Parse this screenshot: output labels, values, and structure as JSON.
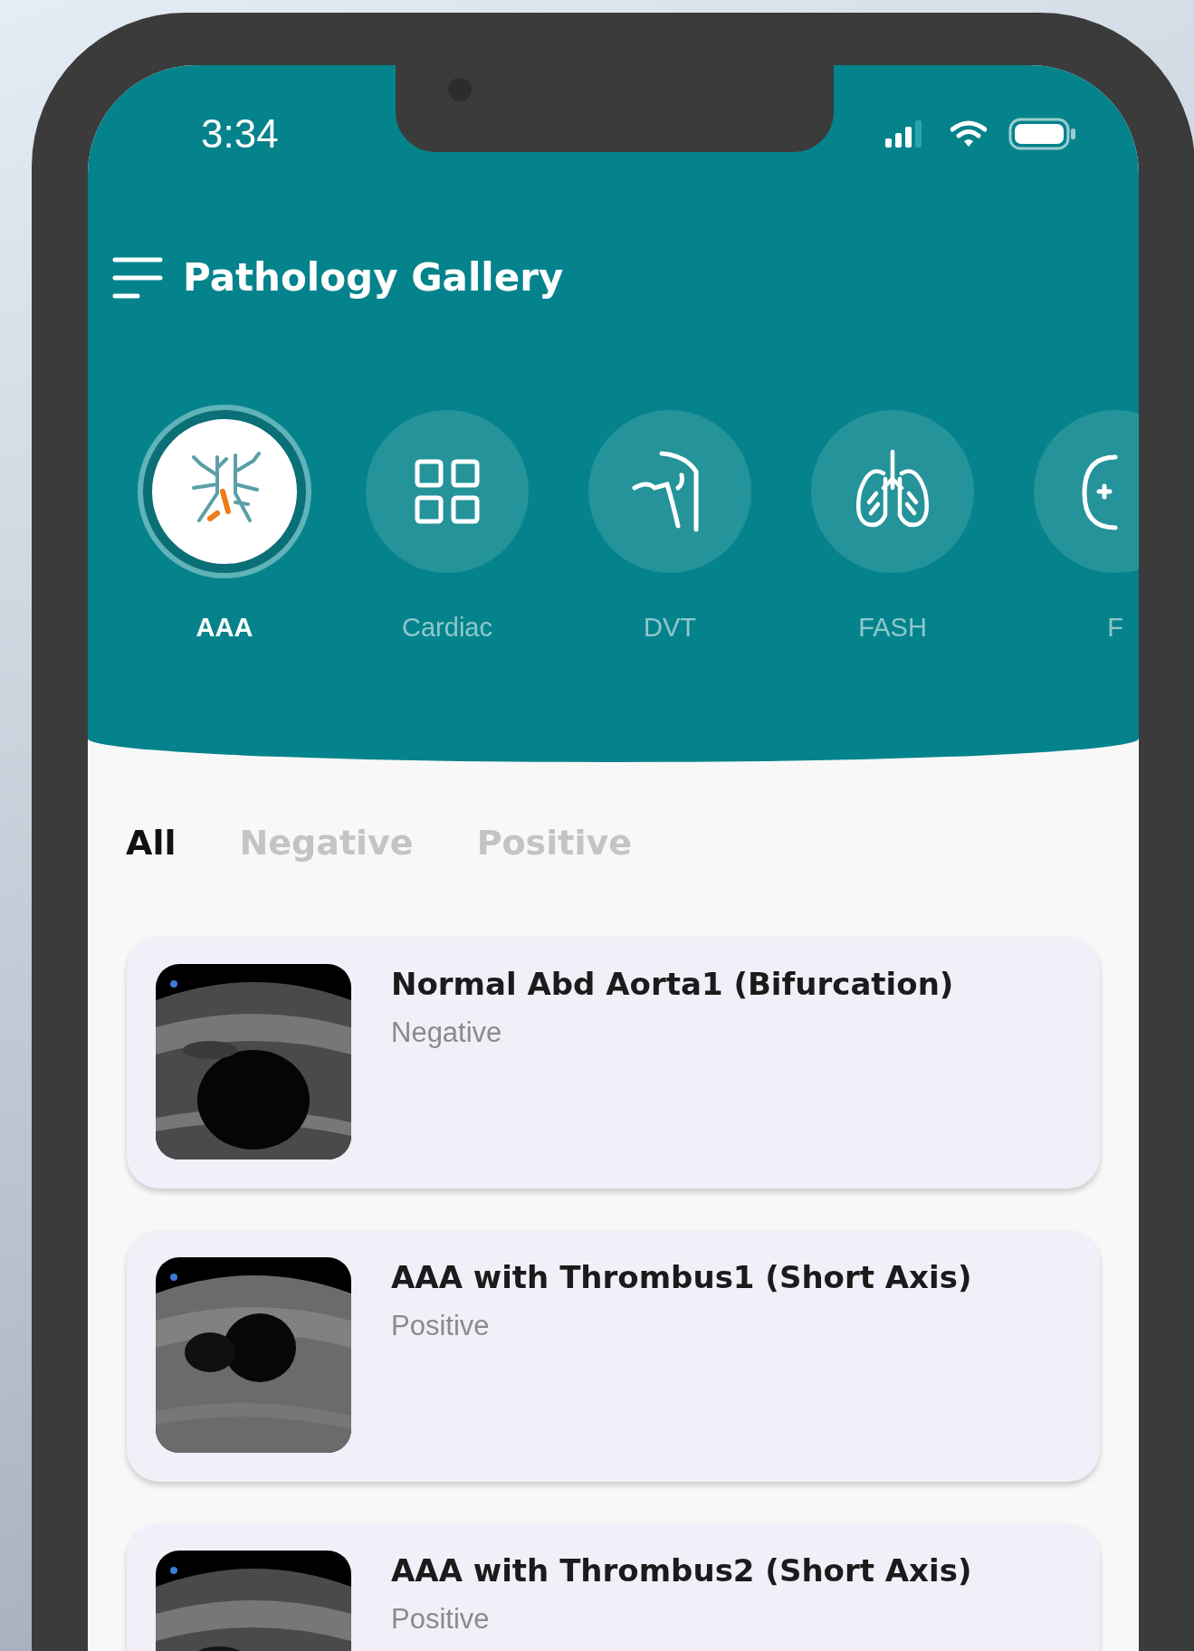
{
  "status_bar": {
    "time": "3:34"
  },
  "header": {
    "title": "Pathology Gallery"
  },
  "categories": [
    {
      "label": "AAA",
      "selected": true,
      "kind": "vessels"
    },
    {
      "label": "Cardiac",
      "selected": false,
      "kind": "grid"
    },
    {
      "label": "DVT",
      "selected": false,
      "kind": "leg"
    },
    {
      "label": "FASH",
      "selected": false,
      "kind": "lungs"
    },
    {
      "label": "F",
      "selected": false,
      "kind": "organ"
    }
  ],
  "filters": [
    {
      "label": "All",
      "selected": true
    },
    {
      "label": "Negative",
      "selected": false
    },
    {
      "label": "Positive",
      "selected": false
    }
  ],
  "cases": [
    {
      "title": "Normal Abd Aorta1 (Bifurcation)",
      "result": "Negative"
    },
    {
      "title": "AAA with Thrombus1 (Short Axis)",
      "result": "Positive"
    },
    {
      "title": "AAA with Thrombus2 (Short Axis)",
      "result": "Positive"
    }
  ]
}
